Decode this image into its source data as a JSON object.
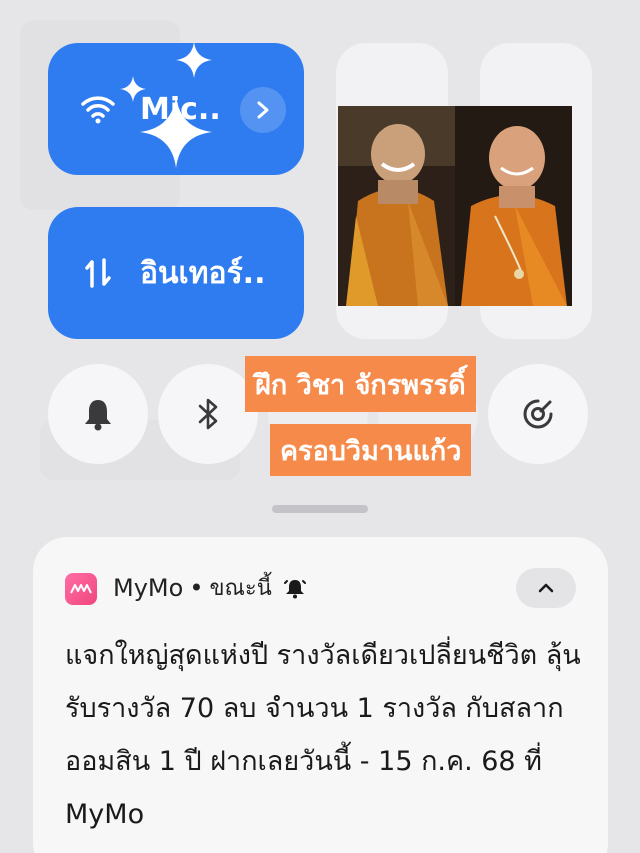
{
  "quick_settings": {
    "wifi": {
      "label": "Mic..",
      "icon": "wifi-icon",
      "color": "#2f7cf0"
    },
    "mobile_data": {
      "label": "อินเทอร์..",
      "icon": "data-transfer-icon",
      "color": "#2f7cf0"
    },
    "round_buttons": [
      {
        "icon": "bell-icon"
      },
      {
        "icon": "bluetooth-icon"
      },
      {
        "icon": "target-icon"
      }
    ]
  },
  "overlay": {
    "photo": "two-monks-photo",
    "caption_line1": "ฝึก วิชา  จักรพรรดิ์",
    "caption_line2": "ครอบวิมานแก้ว",
    "caption_color": "#f68a4b"
  },
  "notification": {
    "app_name": "MyMo",
    "separator": "•",
    "time": "ขณะนี้",
    "body": "แจกใหญ่สุดแห่งปี รางวัลเดียวเปลี่ยนชีวิต ลุ้นรับรางวัล 70 ลบ จำนวน 1 รางวัล กับสลากออมสิน 1 ปี ฝากเลยวันนี้ - 15 ก.ค. 68 ที่ MyMo"
  }
}
